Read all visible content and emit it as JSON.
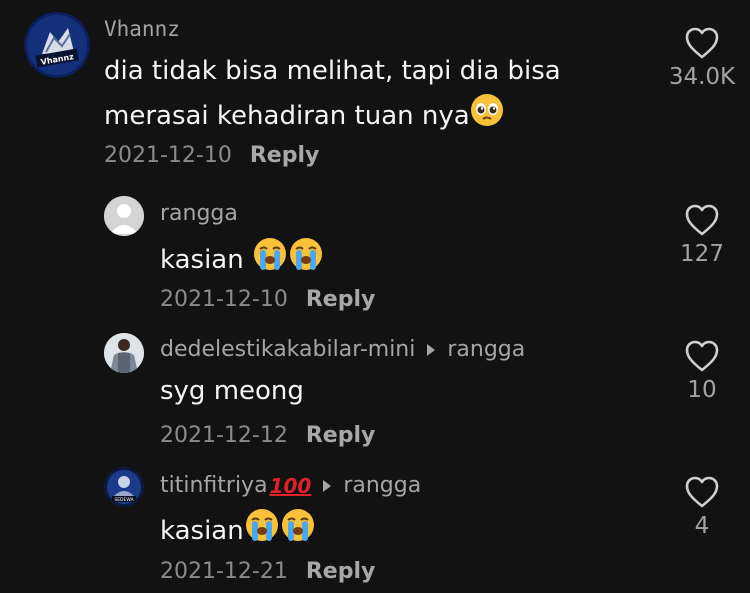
{
  "comments": [
    {
      "username": "Vhannz",
      "text": "dia tidak bisa melihat, tapi dia bisa",
      "text2": "merasai kehadiran tuan nya",
      "date": "2021-12-10",
      "reply_label": "Reply",
      "likes": "34.0K",
      "avatar_text": "Vhannz"
    },
    {
      "username": "rangga",
      "text": "kasian",
      "date": "2021-12-10",
      "reply_label": "Reply",
      "likes": "127"
    },
    {
      "username": "dedelestikakabilar-mini",
      "reply_to": "rangga",
      "text": "syg meong",
      "date": "2021-12-12",
      "reply_label": "Reply",
      "likes": "10"
    },
    {
      "username": "titinfitriya",
      "username_suffix": "100",
      "reply_to": "rangga",
      "text": "kasian",
      "date": "2021-12-21",
      "reply_label": "Reply",
      "likes": "4",
      "avatar_text": "SEDEWA"
    }
  ],
  "colors": {
    "background": "#121212",
    "username": "#a5a5a5",
    "meta": "#8b8b8b"
  },
  "icons": {
    "like": "heart-outline-icon",
    "pleading": "pleading-face-emoji",
    "crying": "loudly-crying-face-emoji"
  }
}
